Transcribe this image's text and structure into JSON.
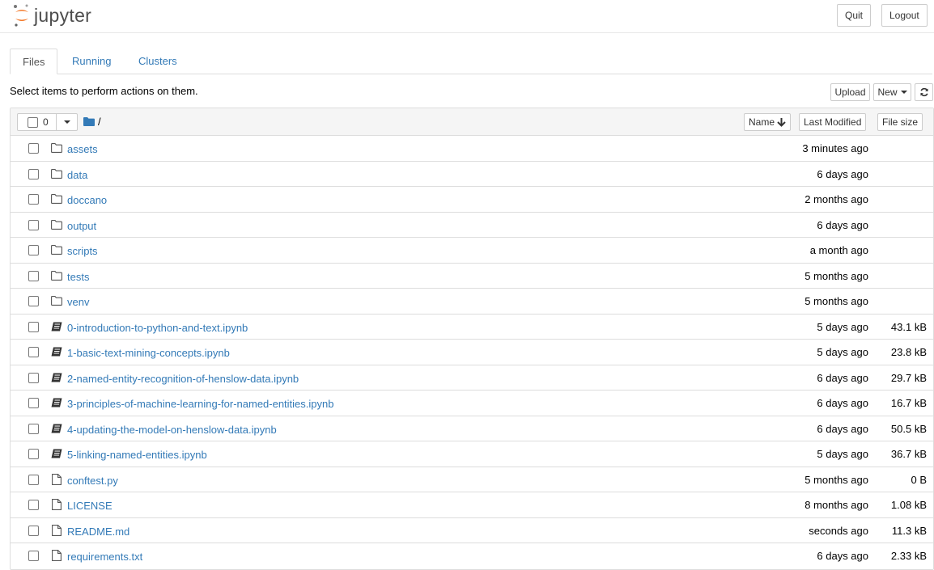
{
  "header": {
    "logo_text": "jupyter",
    "quit_label": "Quit",
    "logout_label": "Logout"
  },
  "tabs": [
    {
      "label": "Files",
      "active": true
    },
    {
      "label": "Running",
      "active": false
    },
    {
      "label": "Clusters",
      "active": false
    }
  ],
  "toolbar": {
    "hint": "Select items to perform actions on them.",
    "upload_label": "Upload",
    "new_label": "New"
  },
  "list_header": {
    "selected_count": "0",
    "breadcrumb": "/",
    "sort_name_label": "Name",
    "sort_modified_label": "Last Modified",
    "sort_size_label": "File size"
  },
  "files": [
    {
      "name": "assets",
      "type": "folder",
      "modified": "3 minutes ago",
      "size": ""
    },
    {
      "name": "data",
      "type": "folder",
      "modified": "6 days ago",
      "size": ""
    },
    {
      "name": "doccano",
      "type": "folder",
      "modified": "2 months ago",
      "size": ""
    },
    {
      "name": "output",
      "type": "folder",
      "modified": "6 days ago",
      "size": ""
    },
    {
      "name": "scripts",
      "type": "folder",
      "modified": "a month ago",
      "size": ""
    },
    {
      "name": "tests",
      "type": "folder",
      "modified": "5 months ago",
      "size": ""
    },
    {
      "name": "venv",
      "type": "folder",
      "modified": "5 months ago",
      "size": ""
    },
    {
      "name": "0-introduction-to-python-and-text.ipynb",
      "type": "notebook",
      "modified": "5 days ago",
      "size": "43.1 kB"
    },
    {
      "name": "1-basic-text-mining-concepts.ipynb",
      "type": "notebook",
      "modified": "5 days ago",
      "size": "23.8 kB"
    },
    {
      "name": "2-named-entity-recognition-of-henslow-data.ipynb",
      "type": "notebook",
      "modified": "6 days ago",
      "size": "29.7 kB"
    },
    {
      "name": "3-principles-of-machine-learning-for-named-entities.ipynb",
      "type": "notebook",
      "modified": "6 days ago",
      "size": "16.7 kB"
    },
    {
      "name": "4-updating-the-model-on-henslow-data.ipynb",
      "type": "notebook",
      "modified": "6 days ago",
      "size": "50.5 kB"
    },
    {
      "name": "5-linking-named-entities.ipynb",
      "type": "notebook",
      "modified": "5 days ago",
      "size": "36.7 kB"
    },
    {
      "name": "conftest.py",
      "type": "file",
      "modified": "5 months ago",
      "size": "0 B"
    },
    {
      "name": "LICENSE",
      "type": "file",
      "modified": "8 months ago",
      "size": "1.08 kB"
    },
    {
      "name": "README.md",
      "type": "file",
      "modified": "seconds ago",
      "size": "11.3 kB"
    },
    {
      "name": "requirements.txt",
      "type": "file",
      "modified": "6 days ago",
      "size": "2.33 kB"
    }
  ],
  "colors": {
    "link": "#337ab7",
    "logo_orange": "#f37726",
    "folder_blue": "#337ab7"
  }
}
